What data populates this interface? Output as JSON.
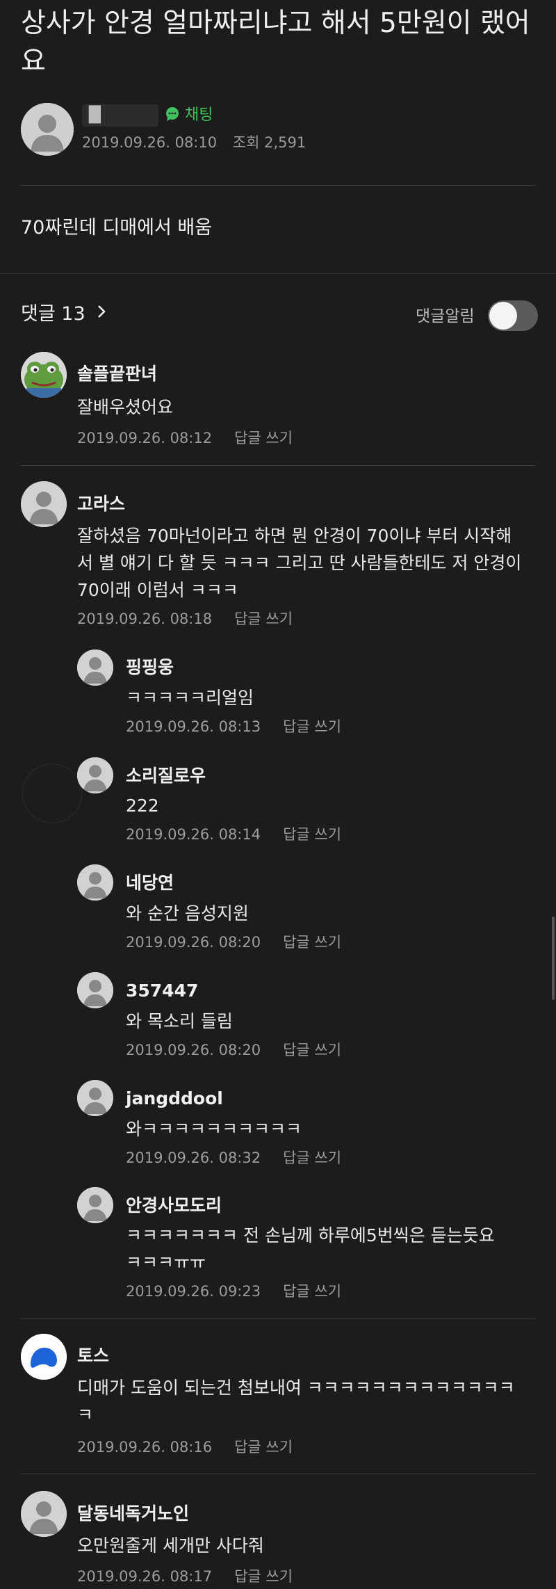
{
  "post": {
    "title": "상사가 안경 얼마짜리냐고 해서 5만원이 랬어요",
    "author_name": "█",
    "tag": "채팅",
    "date": "2019.09.26. 08:10",
    "views": "조회 2,591",
    "body": "70짜린데 디매에서 배움"
  },
  "comments_header": {
    "label": "댓글 13",
    "alarm_label": "댓글알림",
    "alarm_on": false
  },
  "reply_label": "답글 쓰기",
  "comments": [
    {
      "name": "솔플끝판녀",
      "text": "잘배우셨어요",
      "date": "2019.09.26. 08:12",
      "avatar": "frog-avatar"
    },
    {
      "name": "고라스",
      "text": "잘하셨음 70마넌이라고 하면 뭔 안경이 70이냐 부터 시작해서 별 얘기 다 할 듯 ㅋㅋㅋ 그리고 딴 사람들한테도 저 안경이 70이래 이럼서 ㅋㅋㅋ",
      "date": "2019.09.26. 08:18",
      "avatar": "default-avatar"
    },
    {
      "name": "핑핑웅",
      "text": "ㅋㅋㅋㅋㅋ리얼임",
      "date": "2019.09.26. 08:13",
      "avatar": "default-avatar"
    },
    {
      "name": "소리질로우",
      "text": "222",
      "date": "2019.09.26. 08:14",
      "avatar": "default-avatar"
    },
    {
      "name": "네당연",
      "text": "와 순간 음성지원",
      "date": "2019.09.26. 08:20",
      "avatar": "default-avatar"
    },
    {
      "name": "357447",
      "text": "와 목소리 들림",
      "date": "2019.09.26. 08:20",
      "avatar": "default-avatar"
    },
    {
      "name": "jangddool",
      "text": "와ㅋㅋㅋㅋㅋㅋㅋㅋㅋㅋ",
      "date": "2019.09.26. 08:32",
      "avatar": "default-avatar"
    },
    {
      "name": "안경사모도리",
      "text": "ㅋㅋㅋㅋㅋㅋㅋ 전 손님께 하루에5번씩은 듣는듯요ㅋㅋㅋㅠㅠ",
      "date": "2019.09.26. 09:23",
      "avatar": "default-avatar"
    },
    {
      "name": "토스",
      "text": "디매가 도움이 되는건 첨보내여 ㅋㅋㅋㅋㅋㅋㅋㅋㅋㅋㅋㅋㅋㅋ",
      "date": "2019.09.26. 08:16",
      "avatar": "toss-avatar"
    },
    {
      "name": "달동네독거노인",
      "text": "오만원줄게 세개만 사다줘",
      "date": "2019.09.26. 08:17",
      "avatar": "default-avatar"
    }
  ]
}
